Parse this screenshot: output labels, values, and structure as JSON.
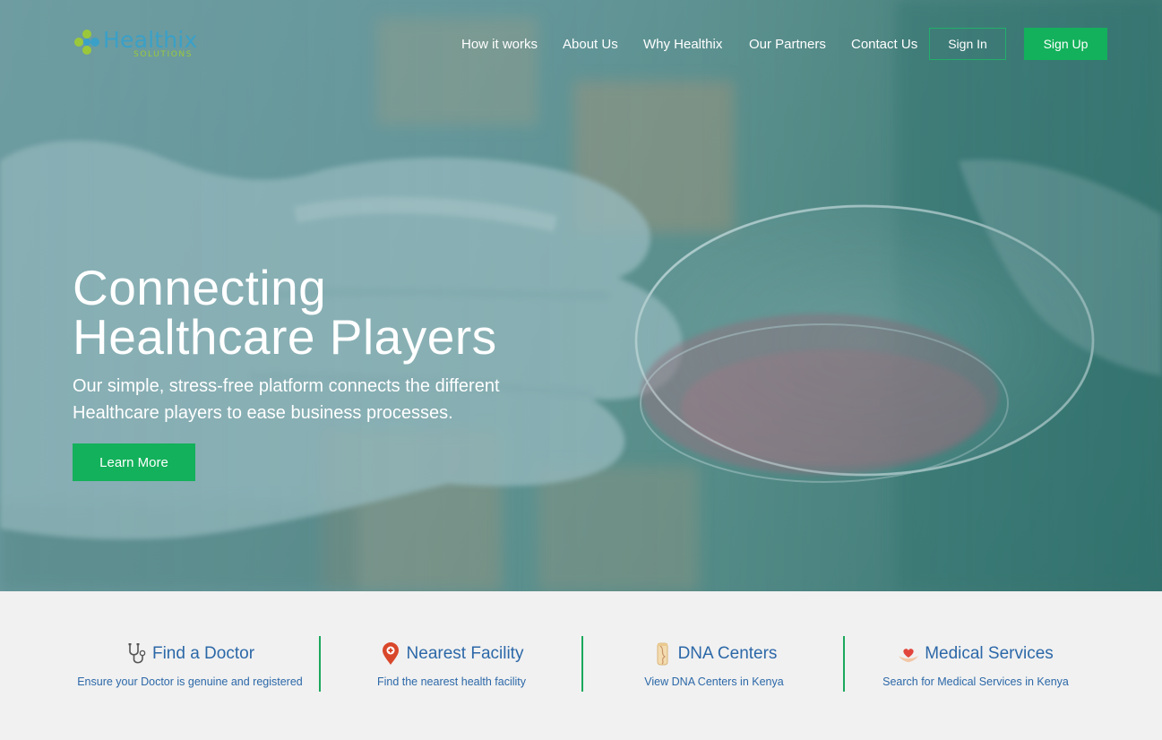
{
  "brand": {
    "name": "Healthix",
    "tagline": "SOLUTIONS",
    "colors": {
      "primary_green": "#13b15b",
      "blue": "#2c68a8",
      "logo_blue": "#3aa0c8",
      "logo_green": "#9bc83a"
    }
  },
  "nav": {
    "items": [
      "How it works",
      "About Us",
      "Why Healthix",
      "Our Partners",
      "Contact Us"
    ],
    "sign_in": "Sign In",
    "sign_up": "Sign Up"
  },
  "hero": {
    "title_line1": "Connecting",
    "title_line2": "Healthcare Players",
    "subtitle_line1": "Our simple, stress-free platform connects the different",
    "subtitle_line2": "Healthcare players to ease business processes.",
    "cta": "Learn More"
  },
  "features": [
    {
      "icon": "stethoscope-icon",
      "title": "Find a Doctor",
      "description": "Ensure your Doctor is genuine and registered"
    },
    {
      "icon": "map-pin-icon",
      "title": "Nearest Facility",
      "description": "Find the nearest health facility"
    },
    {
      "icon": "dna-test-tube-icon",
      "title": "DNA Centers",
      "description": "View DNA Centers in Kenya"
    },
    {
      "icon": "heart-in-hands-icon",
      "title": "Medical Services",
      "description": "Search for Medical Services in Kenya"
    }
  ]
}
